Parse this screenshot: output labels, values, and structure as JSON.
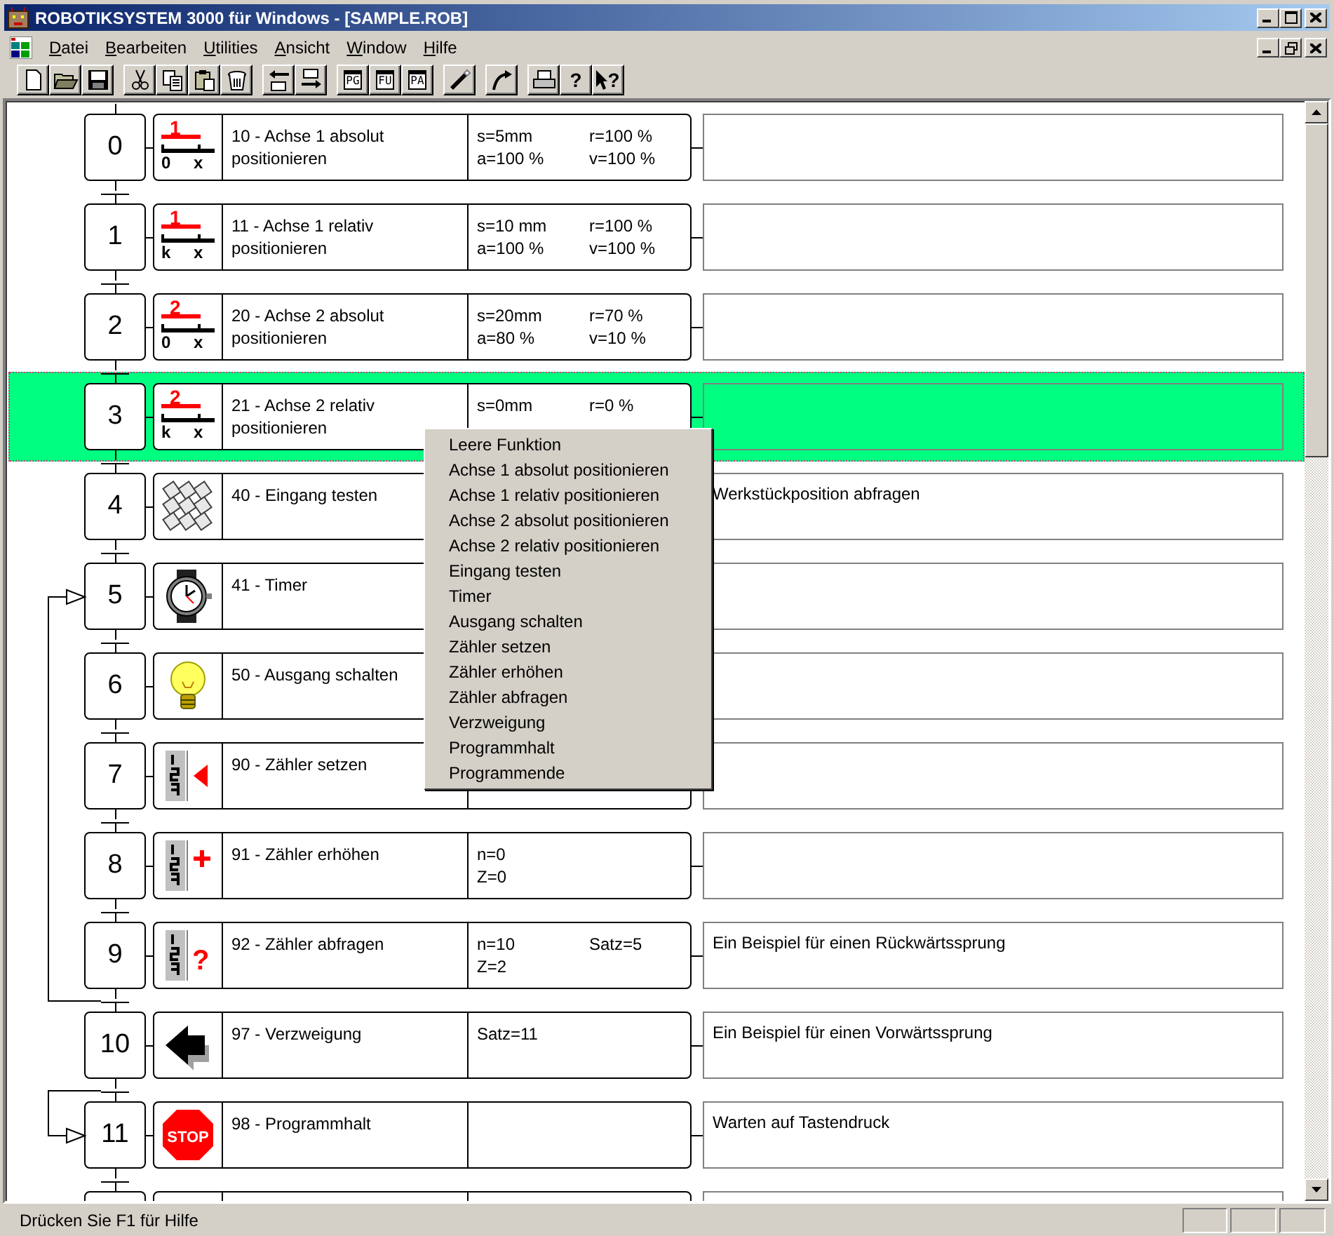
{
  "window": {
    "title": "ROBOTIKSYSTEM 3000 für Windows - [SAMPLE.ROB]"
  },
  "menu": [
    {
      "label": "Datei"
    },
    {
      "label": "Bearbeiten"
    },
    {
      "label": "Utilities"
    },
    {
      "label": "Ansicht"
    },
    {
      "label": "Window"
    },
    {
      "label": "Hilfe"
    }
  ],
  "toolbar": [
    [
      {
        "kind": "new"
      },
      {
        "kind": "open"
      },
      {
        "kind": "save"
      }
    ],
    [
      {
        "kind": "cut"
      },
      {
        "kind": "copy"
      },
      {
        "kind": "paste"
      },
      {
        "kind": "delete"
      }
    ],
    [
      {
        "kind": "move-left"
      },
      {
        "kind": "move-right"
      }
    ],
    [
      {
        "kind": "window",
        "label": "PG"
      },
      {
        "kind": "window",
        "label": "FU"
      },
      {
        "kind": "window",
        "label": "PA"
      }
    ],
    [
      {
        "kind": "tool"
      }
    ],
    [
      {
        "kind": "curve"
      }
    ],
    [
      {
        "kind": "print"
      },
      {
        "kind": "help",
        "label": "?"
      },
      {
        "kind": "context-help",
        "label": "?"
      }
    ]
  ],
  "steps": [
    {
      "number": "0",
      "selected": false,
      "icon": {
        "kind": "axis",
        "digit": "1",
        "origin": "0",
        "axis": "x"
      },
      "function": "10 - Achse 1 absolut positionieren",
      "params": [
        [
          "s=5mm",
          "r=100 %"
        ],
        [
          "a=100 %",
          "v=100 %"
        ]
      ]
    },
    {
      "number": "1",
      "selected": false,
      "icon": {
        "kind": "axis",
        "digit": "1",
        "origin": "k",
        "axis": "x"
      },
      "function": "11 - Achse 1 relativ positionieren",
      "params": [
        [
          "s=10 mm",
          "r=100 %"
        ],
        [
          "a=100 %",
          "v=100 %"
        ]
      ]
    },
    {
      "number": "2",
      "selected": false,
      "icon": {
        "kind": "axis",
        "digit": "2",
        "origin": "0",
        "axis": "x"
      },
      "function": "20 - Achse 2 absolut positionieren",
      "params": [
        [
          "s=20mm",
          "r=70 %"
        ],
        [
          "a=80 %",
          "v=10 %"
        ]
      ]
    },
    {
      "number": "3",
      "selected": true,
      "icon": {
        "kind": "axis",
        "digit": "2",
        "origin": "k",
        "axis": "x"
      },
      "function": "21 - Achse 2 relativ positionieren",
      "params": [
        [
          "s=0mm",
          "r=0 %"
        ]
      ]
    },
    {
      "number": "4",
      "selected": false,
      "icon": {
        "kind": "keypad"
      },
      "function": "40 - Eingang testen",
      "comment": "Werkstückposition abfragen"
    },
    {
      "number": "5",
      "selected": false,
      "icon": {
        "kind": "watch"
      },
      "function": "41 - Timer"
    },
    {
      "number": "6",
      "selected": false,
      "icon": {
        "kind": "bulb"
      },
      "function": "50 - Ausgang schalten"
    },
    {
      "number": "7",
      "selected": false,
      "icon": {
        "kind": "counter-set"
      },
      "function": "90 - Zähler setzen"
    },
    {
      "number": "8",
      "selected": false,
      "icon": {
        "kind": "counter-plus"
      },
      "function": "91 - Zähler erhöhen",
      "params": [
        [
          "n=0"
        ],
        [
          "Z=0"
        ]
      ]
    },
    {
      "number": "9",
      "selected": false,
      "icon": {
        "kind": "counter-query",
        "label": "?"
      },
      "function": "92 - Zähler abfragen",
      "params": [
        [
          "n=10",
          "Satz=5"
        ],
        [
          "Z=2"
        ]
      ],
      "comment": "Ein Beispiel für einen Rückwärtssprung"
    },
    {
      "number": "10",
      "selected": false,
      "icon": {
        "kind": "branch"
      },
      "function": "97 - Verzweigung",
      "params": [
        [
          "Satz=11"
        ]
      ],
      "comment": "Ein Beispiel für einen Vorwärtssprung"
    },
    {
      "number": "11",
      "selected": false,
      "icon": {
        "kind": "stop",
        "label": "STOP"
      },
      "function": "98 - Programmhalt",
      "comment": "Warten auf Tastendruck"
    },
    {
      "selected": false
    }
  ],
  "context_menu": [
    {
      "label": "Leere Funktion"
    },
    {
      "label": "Achse 1 absolut positionieren"
    },
    {
      "label": "Achse 1 relativ positionieren"
    },
    {
      "label": "Achse 2 absolut positionieren"
    },
    {
      "label": "Achse 2 relativ positionieren"
    },
    {
      "label": "Eingang testen"
    },
    {
      "label": "Timer"
    },
    {
      "label": "Ausgang schalten"
    },
    {
      "label": "Zähler setzen"
    },
    {
      "label": "Zähler erhöhen"
    },
    {
      "label": "Zähler abfragen"
    },
    {
      "label": "Verzweigung"
    },
    {
      "label": "Programmhalt"
    },
    {
      "label": "Programmende"
    }
  ],
  "status_bar": {
    "text": "Drücken Sie F1 für Hilfe"
  }
}
